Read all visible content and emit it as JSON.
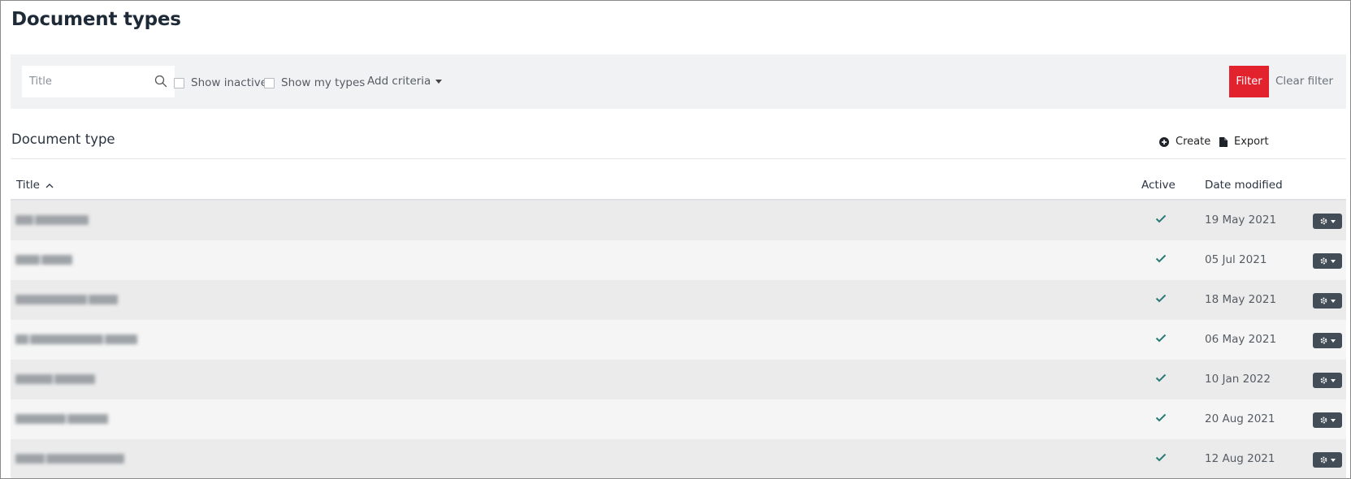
{
  "page": {
    "title": "Document types"
  },
  "filter": {
    "search_placeholder": "Title",
    "show_inactive_label": "Show inactive",
    "show_my_types_label": "Show my types",
    "add_criteria_label": "Add criteria",
    "filter_button_label": "Filter",
    "clear_filter_label": "Clear filter",
    "accent_color": "#e2222d"
  },
  "section": {
    "title": "Document type",
    "create_label": "Create",
    "export_label": "Export"
  },
  "table": {
    "columns": {
      "title": "Title",
      "active": "Active",
      "date_modified": "Date modified"
    },
    "sort": {
      "column": "title",
      "direction": "ascending"
    },
    "rows": [
      {
        "active": true,
        "date_modified": "19 May 2021"
      },
      {
        "active": true,
        "date_modified": "05 Jul 2021"
      },
      {
        "active": true,
        "date_modified": "18 May 2021"
      },
      {
        "active": true,
        "date_modified": "06 May 2021"
      },
      {
        "active": true,
        "date_modified": "10 Jan 2022"
      },
      {
        "active": true,
        "date_modified": "20 Aug 2021"
      },
      {
        "active": true,
        "date_modified": "12 Aug 2021"
      }
    ],
    "check_color": "#2b7a78"
  }
}
